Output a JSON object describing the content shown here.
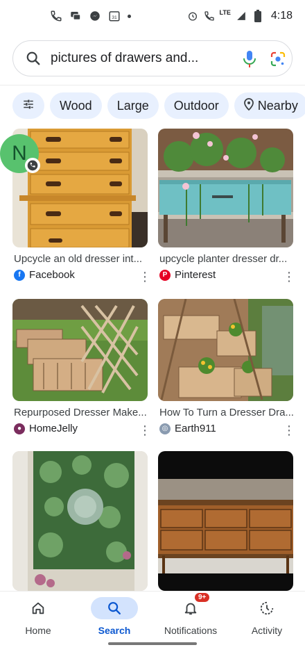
{
  "status_bar": {
    "time": "4:18",
    "network": "LTE",
    "calendar_day": "31"
  },
  "search": {
    "query": "pictures of drawers and..."
  },
  "chips": [
    {
      "label": "",
      "icon": "tune-icon"
    },
    {
      "label": "Wood"
    },
    {
      "label": "Large"
    },
    {
      "label": "Outdoor"
    },
    {
      "label": "Nearby",
      "icon": "location-pin-icon"
    }
  ],
  "avatar": {
    "letter": "N"
  },
  "results": [
    {
      "title": "Upcycle an old dresser int...",
      "source": "Facebook",
      "source_color": "#1877f2"
    },
    {
      "title": "upcycle planter dresser dr...",
      "source": "Pinterest",
      "source_color": "#e60023"
    },
    {
      "title": "Repurposed Dresser Make...",
      "source": "HomeJelly",
      "source_color": "#7b2d5e"
    },
    {
      "title": "How To Turn a Dresser Dra...",
      "source": "Earth911",
      "source_color": "#8a9bb0"
    }
  ],
  "bottom_nav": {
    "home": "Home",
    "search": "Search",
    "notifications": "Notifications",
    "notifications_badge": "9+",
    "activity": "Activity"
  },
  "colors": {
    "accent": "#0b57d0",
    "chip_bg": "#e8f0fe"
  }
}
